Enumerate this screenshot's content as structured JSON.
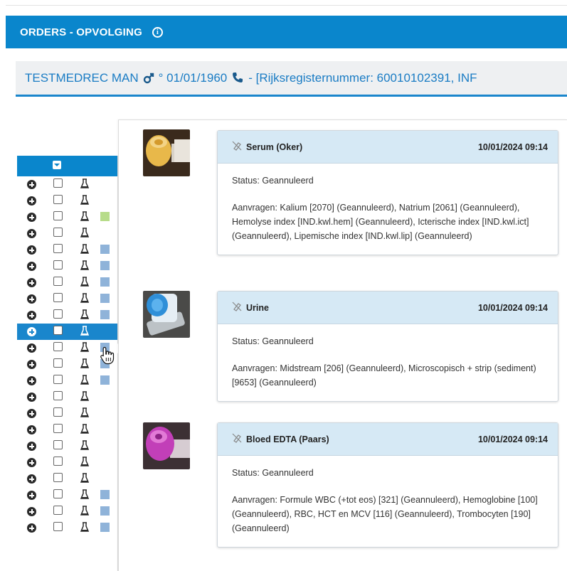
{
  "header": {
    "title": "ORDERS - OPVOLGING",
    "info_icon": "info-icon"
  },
  "patient": {
    "name": "TESTMEDREC MAN",
    "gender_icon": "male-icon",
    "birth": "° 01/01/1960",
    "phone_icon": "phone-icon",
    "extra": "- [Rijksregisternummer: 60010102391, INF"
  },
  "list": {
    "rows": [
      {
        "color": ""
      },
      {
        "color": ""
      },
      {
        "color": "#b7dc8a"
      },
      {
        "color": ""
      },
      {
        "color": "#8fb3d9"
      },
      {
        "color": "#8fb3d9"
      },
      {
        "color": "#8fb3d9"
      },
      {
        "color": "#8fb3d9"
      },
      {
        "color": "#8fb3d9"
      },
      {
        "color": "",
        "selected": true
      },
      {
        "color": "#8fb3d9"
      },
      {
        "color": "#8fb3d9"
      },
      {
        "color": "#8fb3d9"
      },
      {
        "color": ""
      },
      {
        "color": ""
      },
      {
        "color": ""
      },
      {
        "color": ""
      },
      {
        "color": ""
      },
      {
        "color": ""
      },
      {
        "color": "#8fb3d9"
      },
      {
        "color": "#8fb3d9"
      },
      {
        "color": "#8fb3d9"
      }
    ]
  },
  "samples": [
    {
      "title": "Serum (Oker)",
      "datetime": "10/01/2024 09:14",
      "status": "Status: Geannuleerd",
      "requests": "Aanvragen: Kalium [2070] (Geannuleerd), Natrium [2061] (Geannuleerd), Hemolyse index [IND.kwl.hem] (Geannuleerd), Icterische index [IND.kwl.ict] (Geannuleerd), Lipemische index [IND.kwl.lip] (Geannuleerd)",
      "cap_color": "#e8b84a"
    },
    {
      "title": "Urine",
      "datetime": "10/01/2024 09:14",
      "status": "Status: Geannuleerd",
      "requests": "Aanvragen: Midstream [206] (Geannuleerd), Microscopisch + strip (sediment) [9653] (Geannuleerd)",
      "cap_color": "#2f8fd8"
    },
    {
      "title": "Bloed EDTA (Paars)",
      "datetime": "10/01/2024 09:14",
      "status": "Status: Geannuleerd",
      "requests": "Aanvragen: Formule WBC (+tot eos) [321] (Geannuleerd), Hemoglobine [100] (Geannuleerd), RBC, HCT en MCV [116] (Geannuleerd), Trombocyten [190] (Geannuleerd)",
      "cap_color": "#c23fb8"
    }
  ]
}
